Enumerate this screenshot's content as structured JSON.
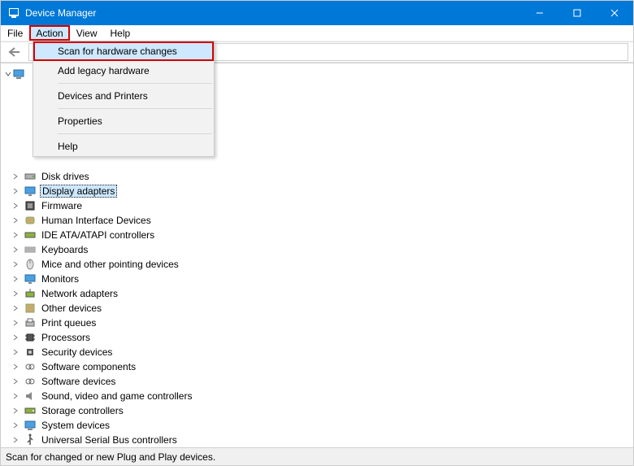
{
  "window": {
    "title": "Device Manager"
  },
  "menu": {
    "items": [
      "File",
      "Action",
      "View",
      "Help"
    ],
    "active_index": 1
  },
  "dropdown": {
    "items": [
      {
        "label": "Scan for hardware changes",
        "highlight": true
      },
      {
        "label": "Add legacy hardware"
      },
      {
        "sep": true
      },
      {
        "label": "Devices and Printers"
      },
      {
        "sep": true
      },
      {
        "label": "Properties"
      },
      {
        "sep": true
      },
      {
        "label": "Help"
      }
    ]
  },
  "tree": {
    "root_label": "",
    "nodes": [
      {
        "label": "",
        "icon": "hidden"
      },
      {
        "label": "",
        "icon": "hidden"
      },
      {
        "label": "",
        "icon": "hidden"
      },
      {
        "label": "",
        "icon": "hidden"
      },
      {
        "label": "",
        "icon": "hidden"
      },
      {
        "label": "",
        "icon": "hidden"
      },
      {
        "label": "Disk drives",
        "icon": "disk"
      },
      {
        "label": "Display adapters",
        "icon": "display",
        "selected": true
      },
      {
        "label": "Firmware",
        "icon": "firmware"
      },
      {
        "label": "Human Interface Devices",
        "icon": "hid"
      },
      {
        "label": "IDE ATA/ATAPI controllers",
        "icon": "ide"
      },
      {
        "label": "Keyboards",
        "icon": "keyboard"
      },
      {
        "label": "Mice and other pointing devices",
        "icon": "mouse"
      },
      {
        "label": "Monitors",
        "icon": "monitor"
      },
      {
        "label": "Network adapters",
        "icon": "network"
      },
      {
        "label": "Other devices",
        "icon": "other"
      },
      {
        "label": "Print queues",
        "icon": "printq"
      },
      {
        "label": "Processors",
        "icon": "cpu"
      },
      {
        "label": "Security devices",
        "icon": "security"
      },
      {
        "label": "Software components",
        "icon": "softcomp"
      },
      {
        "label": "Software devices",
        "icon": "softdev"
      },
      {
        "label": "Sound, video and game controllers",
        "icon": "sound"
      },
      {
        "label": "Storage controllers",
        "icon": "storage"
      },
      {
        "label": "System devices",
        "icon": "system"
      },
      {
        "label": "Universal Serial Bus controllers",
        "icon": "usb"
      }
    ]
  },
  "status": {
    "text": "Scan for changed or new Plug and Play devices."
  }
}
